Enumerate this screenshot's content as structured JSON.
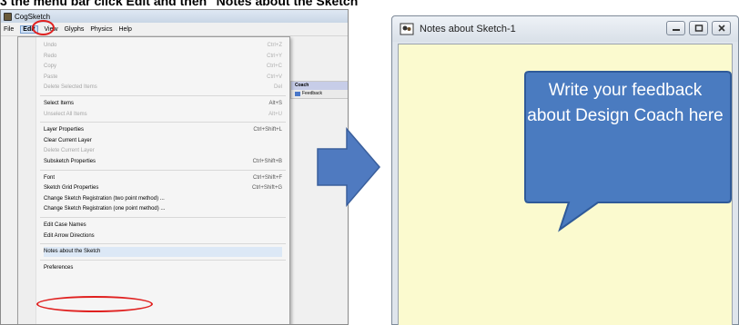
{
  "caption": "3 the menu bar click Edit and then \"Notes about the Sketch\"",
  "cogsketch": {
    "title": "CogSketch",
    "menus": [
      "File",
      "Edit",
      "View",
      "Glyphs",
      "Physics",
      "Help"
    ],
    "active_menu_index": 1,
    "toolbar_peek": {
      "header": "Coach",
      "item": "Feedback"
    }
  },
  "edit_menu": [
    {
      "label": "Undo",
      "shortcut": "Ctrl+Z",
      "disabled": true
    },
    {
      "label": "Redo",
      "shortcut": "Ctrl+Y",
      "disabled": true
    },
    {
      "label": "Copy",
      "shortcut": "Ctrl+C",
      "disabled": true
    },
    {
      "label": "Paste",
      "shortcut": "Ctrl+V",
      "disabled": true
    },
    {
      "label": "Delete Selected Items",
      "shortcut": "Del",
      "disabled": true
    },
    {
      "label": "Select Items",
      "shortcut": "Alt+S",
      "disabled": false
    },
    {
      "label": "Unselect All Items",
      "shortcut": "Alt+U",
      "disabled": true
    },
    {
      "label": "Layer Properties",
      "shortcut": "Ctrl+Shift+L",
      "disabled": false
    },
    {
      "label": "Clear Current Layer",
      "shortcut": "",
      "disabled": false
    },
    {
      "label": "Delete Current Layer",
      "shortcut": "",
      "disabled": true
    },
    {
      "label": "Subsketch Properties",
      "shortcut": "Ctrl+Shift+B",
      "disabled": false
    },
    {
      "label": "Font",
      "shortcut": "Ctrl+Shift+F",
      "disabled": false
    },
    {
      "label": "Sketch Grid Properties",
      "shortcut": "Ctrl+Shift+G",
      "disabled": false
    },
    {
      "label": "Change Sketch Registration (two point method) ...",
      "shortcut": "",
      "disabled": false
    },
    {
      "label": "Change Sketch Registration (one point method) ...",
      "shortcut": "",
      "disabled": false
    },
    {
      "label": "Edit Case Names",
      "shortcut": "",
      "disabled": false
    },
    {
      "label": "Edit Arrow Directions",
      "shortcut": "",
      "disabled": false
    },
    {
      "label": "Notes about the Sketch",
      "shortcut": "",
      "disabled": false,
      "selected": true
    },
    {
      "label": "Preferences",
      "shortcut": "",
      "disabled": false
    }
  ],
  "notes_window": {
    "title": "Notes about Sketch-1",
    "callout_text": "Write your feedback about Design Coach here"
  },
  "colors": {
    "highlight": "#e0201f",
    "arrow": "#4f7ac0",
    "callout": "#4a7bc0",
    "notes_background": "#fbfacf"
  }
}
